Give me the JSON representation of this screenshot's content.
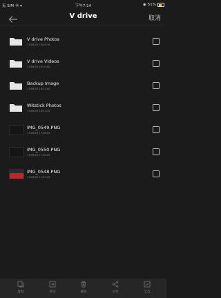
{
  "status_bar": {
    "carrier": "无 SIM 卡",
    "time": "下午7:14",
    "battery": "51%"
  },
  "nav": {
    "title": "V drive",
    "cancel_label": "取消"
  },
  "files": [
    {
      "name": "V drive Photos",
      "date": "17/06/20 16:09:18",
      "kind": "folder"
    },
    {
      "name": "V drive Videos",
      "date": "17/06/20 16:10:00",
      "kind": "folder"
    },
    {
      "name": "Backup Image",
      "date": "17/06/20 16:11:00",
      "kind": "folder"
    },
    {
      "name": "Witstick Photos",
      "date": "17/06/20 16:51:35",
      "kind": "folder"
    },
    {
      "name": "IMG_0549.PNG",
      "date": "17/06/20 17:08:02",
      "kind": "image"
    },
    {
      "name": "IMG_0550.PNG",
      "date": "17/06/20 17:08:09",
      "kind": "image"
    },
    {
      "name": "IMG_0548.PNG",
      "date": "17/06/20 17:07:43",
      "kind": "image"
    }
  ],
  "actions": {
    "copy": "复制",
    "move": "移动",
    "delete": "删除",
    "share": "分享",
    "select_all": "全选"
  },
  "colors": {
    "background": "#1b1b1b",
    "bottom_bar": "#262626",
    "battery": "#f5c518"
  }
}
